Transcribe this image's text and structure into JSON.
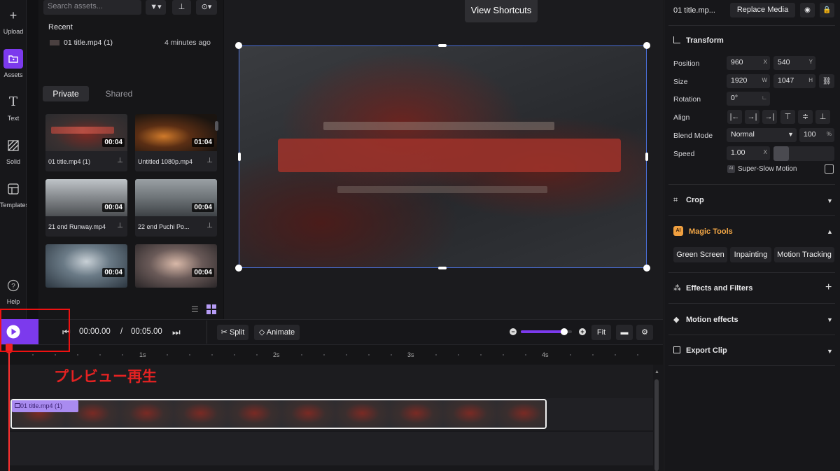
{
  "sidebar": {
    "items": [
      {
        "label": "Upload",
        "icon": "plus-icon"
      },
      {
        "label": "Assets",
        "icon": "folder-icon"
      },
      {
        "label": "Text",
        "icon": "text-icon"
      },
      {
        "label": "Solid",
        "icon": "solid-icon"
      },
      {
        "label": "Templates",
        "icon": "templates-icon"
      }
    ],
    "help_label": "Help"
  },
  "assets": {
    "search_placeholder": "Search assets...",
    "recent_label": "Recent",
    "recent_item": {
      "name": "01 title.mp4 (1)",
      "time": "4 minutes ago"
    },
    "tabs": [
      "Private",
      "Shared"
    ],
    "items": [
      {
        "name": "01 title.mp4 (1)",
        "duration": "00:04"
      },
      {
        "name": "Untitled 1080p.mp4",
        "duration": "01:04"
      },
      {
        "name": "21 end Runway.mp4",
        "duration": "00:04"
      },
      {
        "name": "22 end Puchi Po...",
        "duration": "00:04"
      },
      {
        "name": "",
        "duration": "00:04"
      },
      {
        "name": "",
        "duration": "00:04"
      }
    ]
  },
  "preview": {
    "shortcuts_label": "View Shortcuts"
  },
  "properties": {
    "clip_name": "01 title.mp...",
    "replace_label": "Replace Media",
    "transform_title": "Transform",
    "position_label": "Position",
    "position_x": "960",
    "position_y": "540",
    "size_label": "Size",
    "size_w": "1920",
    "size_h": "1047",
    "rotation_label": "Rotation",
    "rotation": "0°",
    "align_label": "Align",
    "blend_label": "Blend Mode",
    "blend_mode": "Normal",
    "opacity": "100",
    "speed_label": "Speed",
    "speed": "1.00",
    "super_slow_label": "Super-Slow Motion",
    "crop_title": "Crop",
    "magic_title": "Magic Tools",
    "magic_tools": [
      "Green Screen",
      "Inpainting",
      "Motion Tracking"
    ],
    "effects_title": "Effects and Filters",
    "motion_title": "Motion effects",
    "export_title": "Export Clip"
  },
  "timeline": {
    "current_time": "00:00.00",
    "separator": "/",
    "total_time": "00:05.00",
    "split_label": "Split",
    "animate_label": "Animate",
    "fit_label": "Fit",
    "zoom_level": 0.85,
    "ruler": [
      "1s",
      "2s",
      "3s",
      "4s"
    ],
    "clip_label": "01 title.mp4 (1)"
  },
  "annotation": {
    "caption": "プレビュー再生"
  },
  "colors": {
    "accent": "#7c3aed",
    "highlight": "#e11111",
    "selection": "#4a6fd8"
  }
}
